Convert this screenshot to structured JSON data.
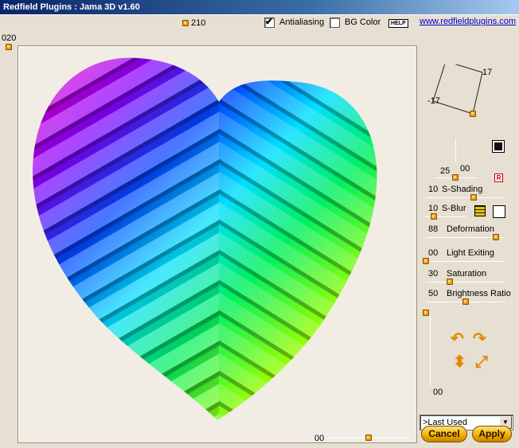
{
  "window": {
    "title": "Redfield Plugins : Jama 3D  v1.60"
  },
  "header": {
    "top_value": "210",
    "left_value": "020",
    "antialiasing_label": "Antialiasing",
    "antialiasing_checked": true,
    "bg_color_label": "BG Color",
    "bg_color_checked": false,
    "help_label": "HELP",
    "link_text": "www.redfieldplugins.com"
  },
  "rotation": {
    "value_a": "17",
    "value_b": "-17"
  },
  "controls": {
    "vertical_slider_value": "00",
    "depth_value": "25",
    "s_shading": {
      "value": "10",
      "label": "S-Shading"
    },
    "s_blur": {
      "value": "10",
      "label": "S-Blur"
    },
    "deformation": {
      "value": "88",
      "label": "Deformation"
    },
    "light_exiting": {
      "value": "00",
      "label": "Light Exiting"
    },
    "saturation": {
      "value": "30",
      "label": "Saturation"
    },
    "brightness_ratio": {
      "value": "50",
      "label": "Brightness Ratio"
    },
    "r_badge": "R",
    "lower_vertical_value": "00"
  },
  "bottom": {
    "slider_value": "00"
  },
  "preset": {
    "selected": ">Last Used"
  },
  "buttons": {
    "cancel": "Cancel",
    "apply": "Apply"
  },
  "colors": {
    "accent_orange": "#f09a10",
    "title_blue": "#0a246a",
    "link_blue": "#0000cc"
  }
}
